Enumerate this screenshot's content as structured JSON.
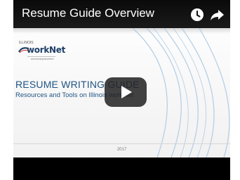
{
  "player": {
    "title": "Resume Guide Overview",
    "icons": {
      "watch_later": "clock-icon",
      "share": "share-arrow-icon",
      "play": "play-icon"
    }
  },
  "slide": {
    "logo": {
      "top_text": "ILLINOIS",
      "main_text": "workNet",
      "center_text": "CENTER",
      "bottom_text": "americanjobcenter"
    },
    "heading": "RESUME WRITING GUIDE",
    "subheading": "Resources and Tools on Illinois workNet",
    "year": "2017"
  },
  "colors": {
    "heading": "#1e5384",
    "play_button": "#212121",
    "top_bar": "#111111",
    "deco_lines": "#a9c8e4"
  }
}
